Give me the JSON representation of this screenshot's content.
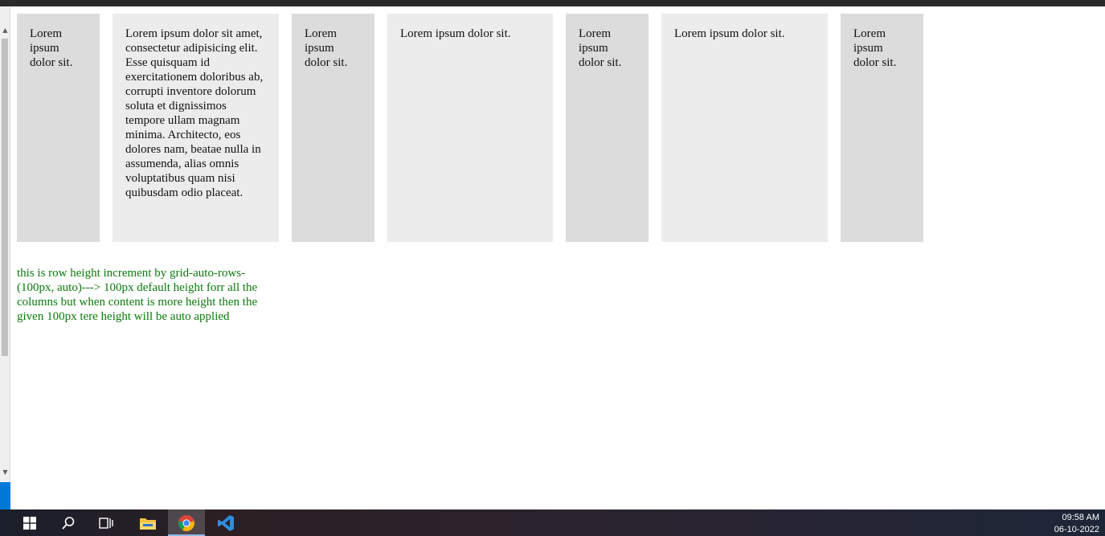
{
  "grid": {
    "cells": [
      "Lorem ipsum dolor sit.",
      "Lorem ipsum dolor sit amet, consectetur adipisicing elit. Esse quisquam id exercitationem doloribus ab, corrupti inventore dolorum soluta et dignissimos tempore ullam magnam minima. Architecto, eos dolores nam, beatae nulla in assumenda, alias omnis voluptatibus quam nisi quibusdam odio placeat.",
      "Lorem ipsum dolor sit.",
      "Lorem ipsum dolor sit.",
      "Lorem ipsum dolor sit.",
      "Lorem ipsum dolor sit.",
      "Lorem ipsum dolor sit."
    ]
  },
  "note": {
    "text": "this is row height increment by grid-auto-rows- (100px, auto)---> 100px default height forr all the columns but when content is more height then the given 100px tere height will be auto applied"
  },
  "taskbar": {
    "icons": [
      "windows-start-icon",
      "search-icon",
      "task-view-icon",
      "file-explorer-icon",
      "chrome-icon",
      "vscode-icon"
    ],
    "time": "09:58 AM",
    "date": "06-10-2022"
  },
  "colors": {
    "cell_dark": "#dcdcdc",
    "cell_light": "#ececec",
    "note_text": "#0b7a0b"
  }
}
